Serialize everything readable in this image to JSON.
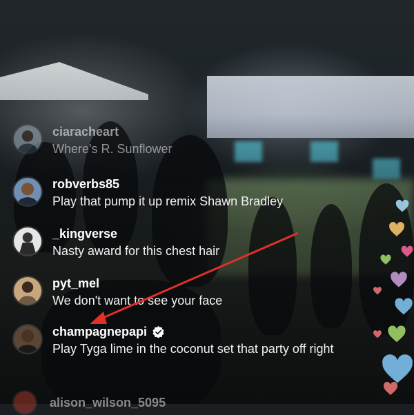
{
  "comments": [
    {
      "username": "ciaracheart",
      "message": "Where's R. Sunflower",
      "avatar_icon": "avatar-icon",
      "faded": true
    },
    {
      "username": "robverbs85",
      "message": "Play that pump it up remix Shawn Bradley",
      "avatar_icon": "avatar-icon"
    },
    {
      "username": "_kingverse",
      "message": "Nasty award for this chest hair",
      "avatar_icon": "avatar-icon"
    },
    {
      "username": "pyt_mel",
      "message": "We don't want to see your face",
      "avatar_icon": "avatar-icon"
    },
    {
      "username": "champagnepapi",
      "message": "Play Tyga lime in the coconut set that party off right",
      "avatar_icon": "avatar-icon",
      "verified": true
    },
    {
      "username": "alison_wilson_5095",
      "message": "",
      "avatar_icon": "avatar-icon",
      "faded": true
    }
  ],
  "icons": {
    "verified": "verified-badge-icon",
    "heart": "heart-icon"
  },
  "colors": {
    "arrow": "#e0302a",
    "text": "#ffffff",
    "hearts": [
      "#7ec0ee",
      "#9ed36a",
      "#e57373",
      "#f06292",
      "#c39bd3",
      "#f5c26b",
      "#a5d6f5"
    ]
  }
}
